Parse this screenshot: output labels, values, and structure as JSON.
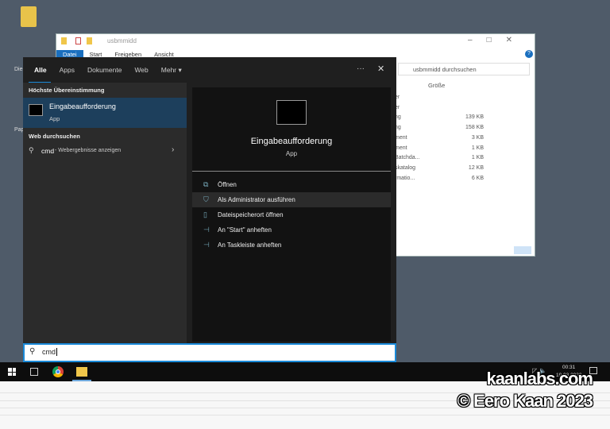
{
  "explorer": {
    "title": "usbmmidd",
    "ribbon": [
      "Datei",
      "Start",
      "Freigeben",
      "Ansicht"
    ],
    "search_placeholder": "usbmmidd durchsuchen",
    "column_size": "Größe",
    "rows": [
      {
        "name": "er",
        "size": ""
      },
      {
        "name": "er",
        "size": ""
      },
      {
        "name": "ng",
        "size": "139 KB"
      },
      {
        "name": "ng",
        "size": "158 KB"
      },
      {
        "name": "ment",
        "size": "3 KB"
      },
      {
        "name": "ment",
        "size": "1 KB"
      },
      {
        "name": "Batchda...",
        "size": "1 KB"
      },
      {
        "name": "skatalog",
        "size": "12 KB"
      },
      {
        "name": "rmatio...",
        "size": "6 KB"
      }
    ]
  },
  "desktop": {
    "icons": [
      "Die",
      "Pap"
    ]
  },
  "search": {
    "tabs": [
      "Alle",
      "Apps",
      "Dokumente",
      "Web",
      "Mehr ▾"
    ],
    "more_icon": "···",
    "close_icon": "✕",
    "best_match_heading": "Höchste Übereinstimmung",
    "best_match": {
      "name": "Eingabeaufforderung",
      "type": "App"
    },
    "web_heading": "Web durchsuchen",
    "web_query": "cmd",
    "web_suffix": " - Webergebnisse anzeigen",
    "preview": {
      "name": "Eingabeaufforderung",
      "type": "App"
    },
    "actions": [
      {
        "label": "Öffnen",
        "icon": "open-icon"
      },
      {
        "label": "Als Administrator ausführen",
        "icon": "admin-shield-icon"
      },
      {
        "label": "Dateispeicherort öffnen",
        "icon": "folder-location-icon"
      },
      {
        "label": "An \"Start\" anheften",
        "icon": "pin-icon"
      },
      {
        "label": "An Taskleiste anheften",
        "icon": "pin-icon"
      }
    ],
    "query": "cmd"
  },
  "taskbar": {
    "time": "00:31",
    "date": "19.03.2023"
  },
  "watermark": {
    "line1": "kaanlabs.com",
    "line2": "© Eero Kaan 2023"
  },
  "colors": {
    "accent": "#1a8ad9",
    "desktop": "#4f5b69",
    "selected": "#1d3f5c"
  }
}
